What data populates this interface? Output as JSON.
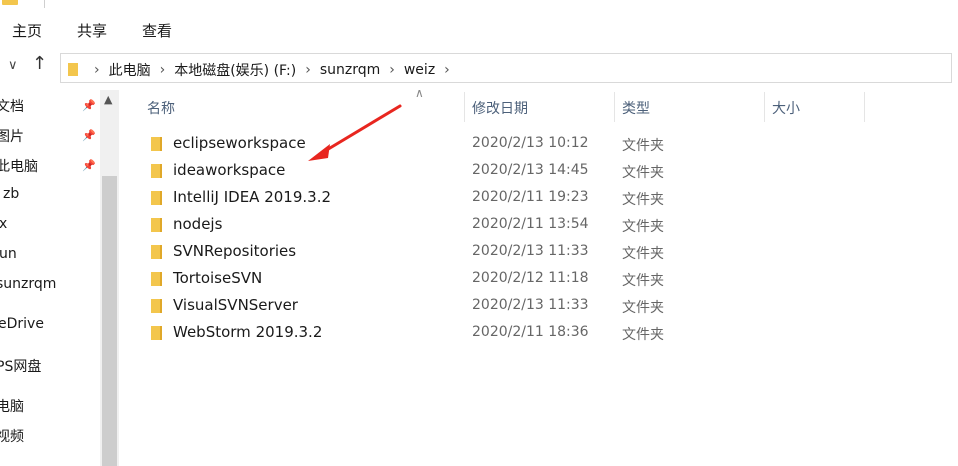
{
  "ribbon": {
    "tabs": [
      "主页",
      "共享",
      "查看"
    ]
  },
  "address": {
    "crumbs": [
      "此电脑",
      "本地磁盘(娱乐) (F:)",
      "sunzrqm",
      "weiz"
    ]
  },
  "sidebar": {
    "items": [
      {
        "label": "文档",
        "pinned": true
      },
      {
        "label": "图片",
        "pinned": true
      },
      {
        "label": "此电脑",
        "pinned": true
      },
      {
        "label": "zb",
        "pinned": false
      },
      {
        "label": "x",
        "pinned": false
      },
      {
        "label": "un",
        "pinned": false
      },
      {
        "label": "sunzrqm",
        "pinned": false
      },
      {
        "label": "eDrive",
        "pinned": false
      },
      {
        "label": "PS网盘",
        "pinned": false
      },
      {
        "label": "电脑",
        "pinned": false
      },
      {
        "label": "视频",
        "pinned": false
      }
    ]
  },
  "columns": {
    "name": "名称",
    "date": "修改日期",
    "type": "类型",
    "size": "大小"
  },
  "files": [
    {
      "name": "eclipseworkspace",
      "date": "2020/2/13 10:12",
      "type": "文件夹"
    },
    {
      "name": "ideaworkspace",
      "date": "2020/2/13 14:45",
      "type": "文件夹"
    },
    {
      "name": "IntelliJ IDEA 2019.3.2",
      "date": "2020/2/11 19:23",
      "type": "文件夹"
    },
    {
      "name": "nodejs",
      "date": "2020/2/11 13:54",
      "type": "文件夹"
    },
    {
      "name": "SVNRepositories",
      "date": "2020/2/13 11:33",
      "type": "文件夹"
    },
    {
      "name": "TortoiseSVN",
      "date": "2020/2/12 11:18",
      "type": "文件夹"
    },
    {
      "name": "VisualSVNServer",
      "date": "2020/2/13 11:33",
      "type": "文件夹"
    },
    {
      "name": "WebStorm 2019.3.2",
      "date": "2020/2/11 18:36",
      "type": "文件夹"
    }
  ],
  "annotation": {
    "arrow_color": "#e8261f"
  },
  "colors": {
    "folder": "#f3c64d",
    "header_text": "#4c607a"
  }
}
